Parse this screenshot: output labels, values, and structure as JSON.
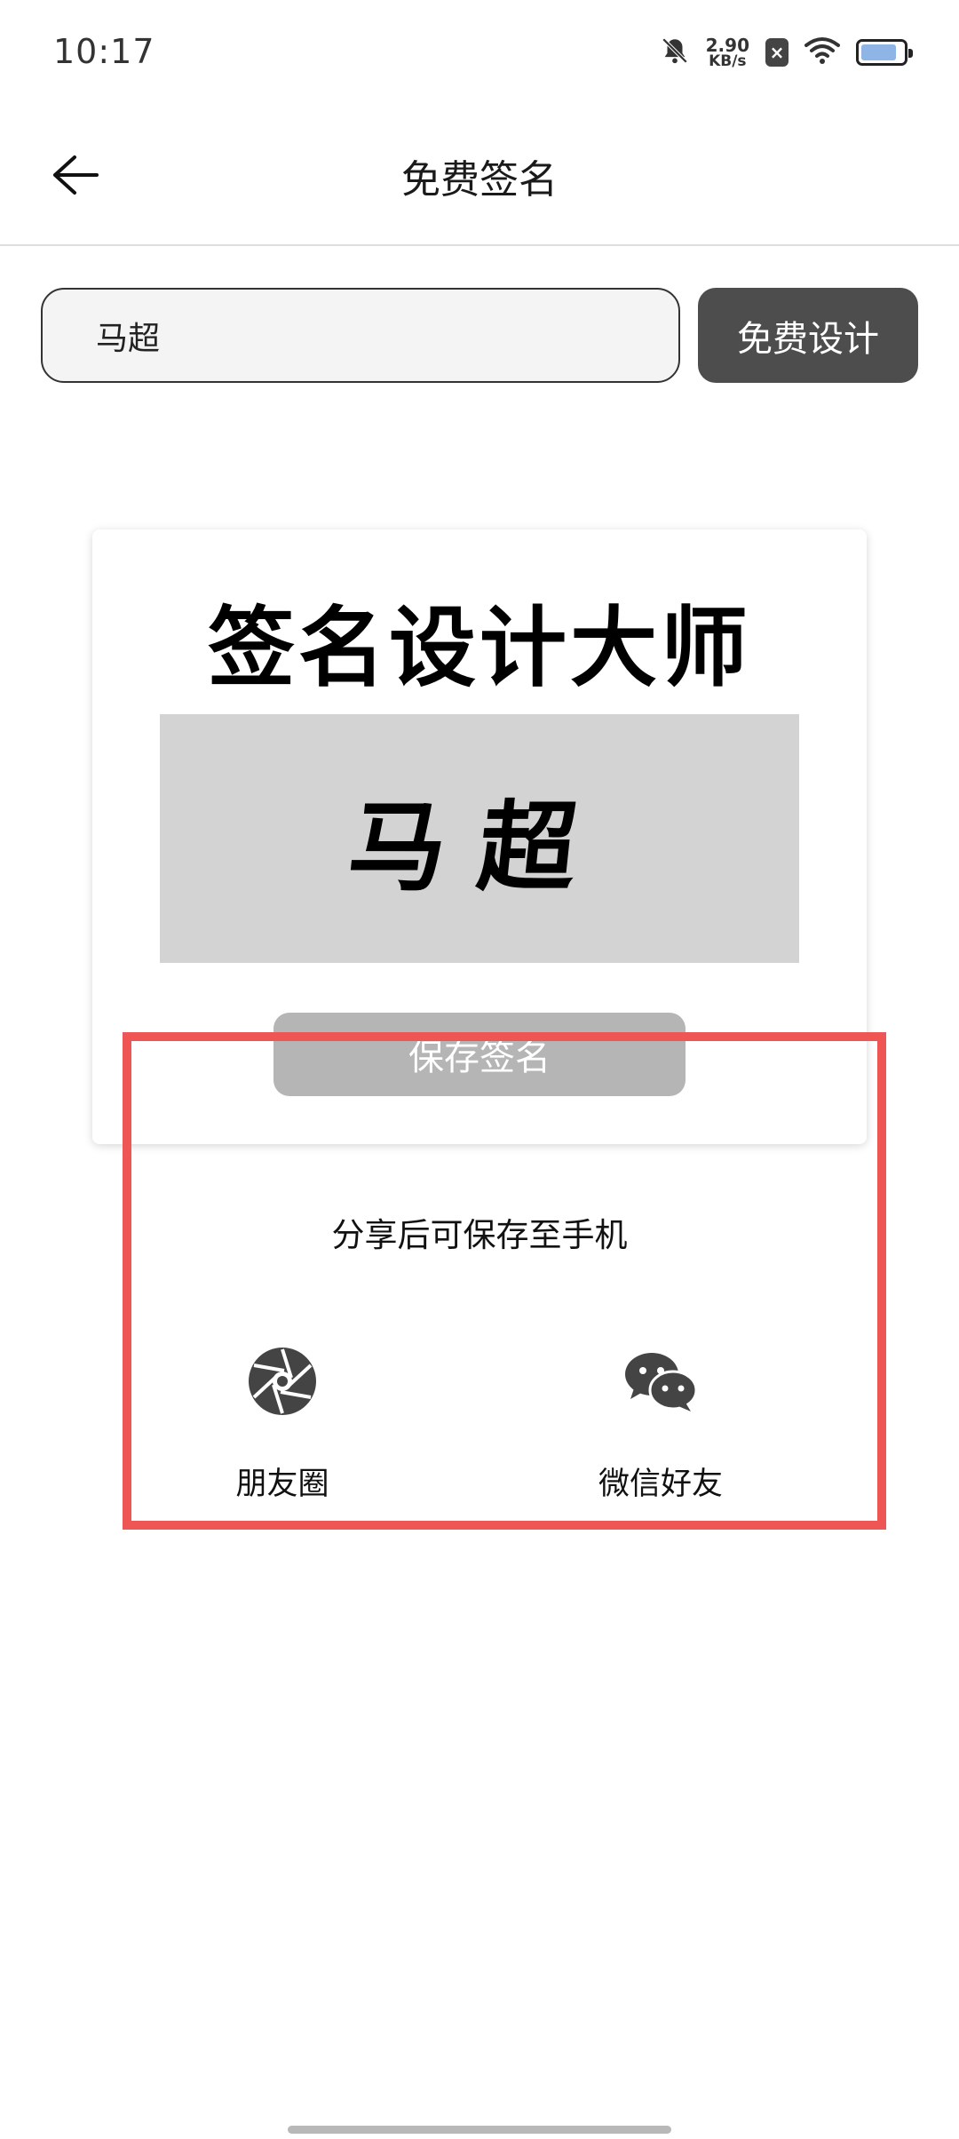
{
  "status_bar": {
    "time": "10:17",
    "net_speed_value": "2.90",
    "net_speed_unit": "KB/s",
    "battery_level": 0.85
  },
  "header": {
    "title": "免费签名"
  },
  "form": {
    "name_value": "马超",
    "design_button": "免费设计"
  },
  "card": {
    "title": "签名设计大师",
    "signature_text": "马超",
    "save_button": "保存签名"
  },
  "share": {
    "hint": "分享后可保存至手机",
    "items": [
      {
        "label": "朋友圈",
        "icon": "moments-icon"
      },
      {
        "label": "微信好友",
        "icon": "wechat-icon"
      }
    ]
  },
  "colors": {
    "design_button_bg": "#4d4d4d",
    "save_button_bg": "#b5b5b5",
    "signature_bg": "#d3d3d3",
    "highlight": "#ee5555"
  }
}
